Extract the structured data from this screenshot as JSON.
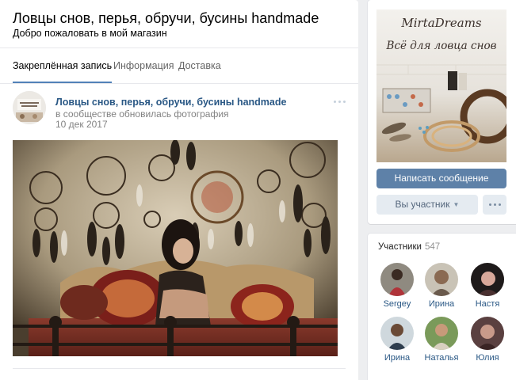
{
  "group": {
    "title": "Ловцы снов, перья, обручи, бусины handmade",
    "status": "Добро пожаловать в мой магазин"
  },
  "tabs": [
    {
      "label": "Закреплённая запись",
      "active": true
    },
    {
      "label": "Информация",
      "active": false
    },
    {
      "label": "Доставка",
      "active": false
    }
  ],
  "post": {
    "author": "Ловцы снов, перья, обручи, бусины handmade",
    "action": "в сообществе обновилась фотография",
    "date": "10 дек 2017",
    "more_icon": "ellipsis-icon"
  },
  "cover": {
    "title": "MirtaDreams",
    "subtitle": "Всё для ловца снов"
  },
  "actions": {
    "write_message": "Написать сообщение",
    "membership": "Вы участник",
    "more_icon": "ellipsis-icon"
  },
  "members": {
    "label": "Участники",
    "count": "547",
    "list": [
      {
        "name": "Sergey"
      },
      {
        "name": "Ирина"
      },
      {
        "name": "Настя"
      },
      {
        "name": "Ирина"
      },
      {
        "name": "Наталья"
      },
      {
        "name": "Юлия"
      }
    ]
  },
  "colors": {
    "page_background": "#edeef0",
    "link": "#2a5885",
    "primary_button": "#5e81a8",
    "secondary_button": "#e5ebf1",
    "active_tab_underline": "#5181b8"
  }
}
